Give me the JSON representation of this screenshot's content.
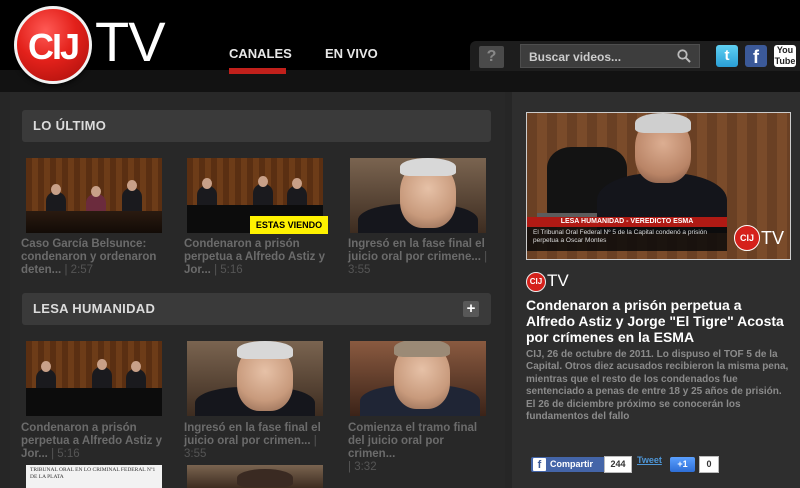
{
  "header": {
    "logo_text": "CIJ",
    "logo_tv": "TV",
    "nav": [
      {
        "label": "CANALES",
        "active": true
      },
      {
        "label": "EN VIVO",
        "active": false
      }
    ],
    "help_label": "?",
    "search_placeholder": "Buscar videos...",
    "social": [
      "twitter-icon",
      "facebook-icon",
      "youtube-icon"
    ],
    "youtube_label": "You Tube"
  },
  "sections": [
    {
      "title": "LO ÚLTIMO",
      "videos": [
        {
          "title_line1": "Caso García Belsunce:",
          "title_line2": "condenaron y ordenaron",
          "title_line3": "deten...",
          "duration": "2:57"
        },
        {
          "title_line1": "Condenaron a prisón",
          "title_line2": "perpetua a Alfredo Astiz y",
          "title_line3": "Jor...",
          "duration": "5:16",
          "badge": "ESTAS VIENDO"
        },
        {
          "title_line1": "Ingresó en la fase final el",
          "title_line2": "juicio oral por crimenе...",
          "title_line3": "",
          "duration": "3:55"
        }
      ]
    },
    {
      "title": "LESA HUMANIDAD",
      "plus": "+",
      "videos": [
        {
          "title_line1": "Condenaron a prisón",
          "title_line2": "perpetua a Alfredo Astiz y",
          "title_line3": "Jor...",
          "duration": "5:16"
        },
        {
          "title_line1": "Ingresó en la fase final el",
          "title_line2": "juicio oral por crimen...",
          "title_line3": "",
          "duration": "3:55"
        },
        {
          "title_line1": "Comienza el tramo final",
          "title_line2": "del juicio oral por crimen...",
          "title_line3": "",
          "duration": "3:32"
        }
      ]
    }
  ],
  "partial_thumb_text": "TRIBUNAL ORAL EN LO CRIMINAL FEDERAL Nº1 DE LA PLATA",
  "player": {
    "lower_third_title": "LESA HUMANIDAD - VEREDICTO ESMA",
    "lower_third_text": "El Tribunal Oral Federal Nº 5 de la Capital condenó a prisión perpetua a Oscar Montes",
    "logo": "CIJ",
    "logo_tv": "TV"
  },
  "article": {
    "brand": "CIJ",
    "brand_tv": "TV",
    "title": "Condenaron a prisón perpetua a Alfredo Astiz y Jorge \"El Tigre\" Acosta por crímenes en la ESMA",
    "body": "CIJ, 26 de octubre de 2011. Lo dispuso el TOF 5 de la Capital. Otros diez acusados recibieron la misma pena, mientras que el resto de los condenados fue sentenciado a penas de entre 18 y 25 años de prisión. El 26 de diciembre próximo se conocerán los fundamentos del fallo"
  },
  "share": {
    "facebook_label": "Compartir",
    "facebook_count": "244",
    "twitter_label": "Tweet",
    "plus_label": "+1",
    "plus_count": "0"
  },
  "colors": {
    "accent": "#c1201b",
    "badge": "#fff200",
    "background": "#262626"
  }
}
